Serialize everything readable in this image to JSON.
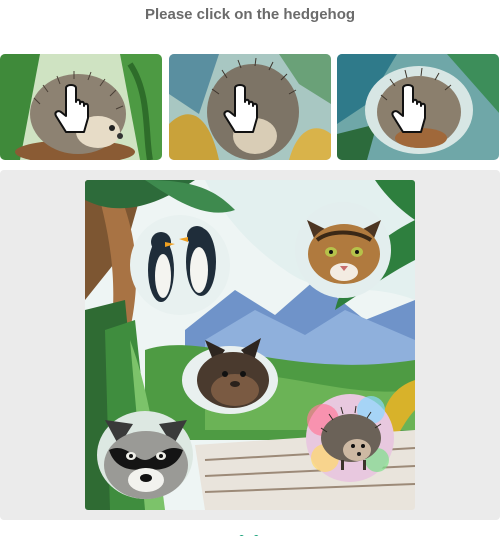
{
  "challenge": {
    "prompt": "Please click on the hedgehog",
    "example_images": [
      {
        "label": "hedgehog-example-1"
      },
      {
        "label": "hedgehog-example-2"
      },
      {
        "label": "hedgehog-example-3"
      }
    ],
    "scene_animals": [
      "penguins",
      "cat",
      "bat",
      "raccoon",
      "hedgehog"
    ]
  },
  "colors": {
    "prompt_text": "#6b6b6b",
    "panel_bg": "#ebebeb",
    "accent_green": "#1aa37a"
  }
}
